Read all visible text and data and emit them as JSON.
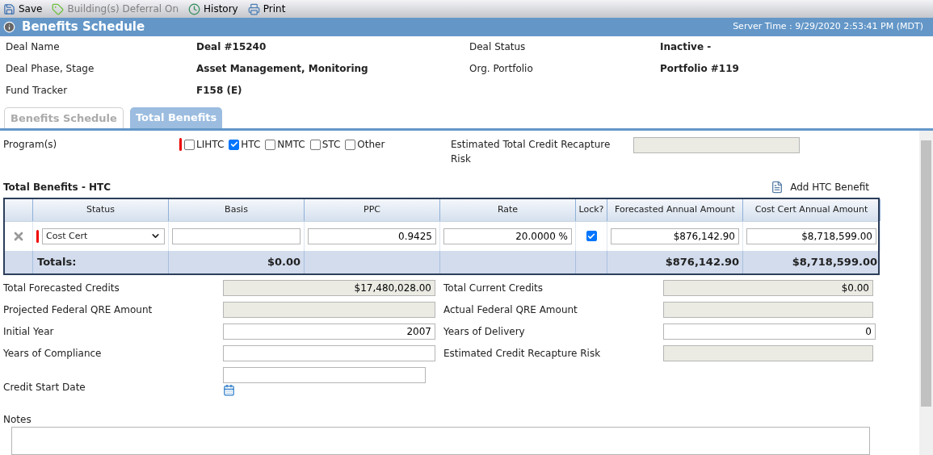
{
  "toolbar": [
    {
      "kind": "save",
      "label": "Save",
      "disabled": false
    },
    {
      "kind": "tag",
      "label": "Building(s) Deferral On",
      "disabled": true
    },
    {
      "kind": "history",
      "label": "History",
      "disabled": false
    },
    {
      "kind": "print",
      "label": "Print",
      "disabled": false
    }
  ],
  "header": {
    "title": "Benefits Schedule",
    "server_time": "Server Time : 9/29/2020 2:53:41 PM (MDT)"
  },
  "deal_info": [
    {
      "label": "Deal Name",
      "value": "Deal #15240"
    },
    {
      "label": "Deal Status",
      "value": "Inactive -"
    },
    {
      "label": "Deal Phase, Stage",
      "value": "Asset Management, Monitoring"
    },
    {
      "label": "Org. Portfolio",
      "value": "Portfolio #119"
    },
    {
      "label": "Fund Tracker",
      "value": "F158 (E)"
    }
  ],
  "tabs": [
    {
      "label": "Benefits Schedule",
      "selected": false
    },
    {
      "label": "Total Benefits",
      "selected": true
    }
  ],
  "programs": {
    "label": "Program(s)",
    "required": true,
    "options": [
      {
        "label": "LIHTC",
        "checked": false
      },
      {
        "label": "HTC",
        "checked": true
      },
      {
        "label": "NMTC",
        "checked": false
      },
      {
        "label": "STC",
        "checked": false
      },
      {
        "label": "Other",
        "checked": false
      }
    ]
  },
  "recapture": {
    "label": "Estimated Total Credit Recapture Risk"
  },
  "section_title": "Total Benefits - HTC",
  "add_button": "Add HTC Benefit",
  "table": {
    "columns": [
      "Status",
      "Basis",
      "PPC",
      "Rate",
      "Lock?",
      "Forecasted Annual Amount",
      "Cost Cert Annual Amount"
    ],
    "rows": [
      {
        "status": "Cost Cert",
        "required": true,
        "ppc": "0.9425",
        "rate": "20.0000 %",
        "locked": true,
        "forecasted": "$876,142.90",
        "cost_cert": "$8,718,599.00"
      }
    ],
    "totals": {
      "label": "Totals:",
      "basis": "$0.00",
      "forecasted": "$876,142.90",
      "cost_cert": "$8,718,599.00"
    }
  },
  "left_fields": [
    {
      "label": "Total Forecasted Credits",
      "kind": "readonly",
      "value": "$17,480,028.00"
    },
    {
      "label": "Projected Federal QRE Amount",
      "kind": "readonly"
    },
    {
      "label": "Initial Year",
      "kind": "input",
      "value": "2007"
    },
    {
      "label": "Years of Compliance",
      "kind": "input"
    },
    {
      "label": "Credit Start Date",
      "kind": "date"
    }
  ],
  "right_fields": [
    {
      "label": "Total Current Credits",
      "kind": "readonly",
      "value": "$0.00"
    },
    {
      "label": "Actual Federal QRE Amount",
      "kind": "readonly"
    },
    {
      "label": "Years of Delivery",
      "kind": "input",
      "value": "0"
    },
    {
      "label": "Estimated Credit Recapture Risk",
      "kind": "readonly"
    }
  ],
  "notes": {
    "label": "Notes"
  }
}
